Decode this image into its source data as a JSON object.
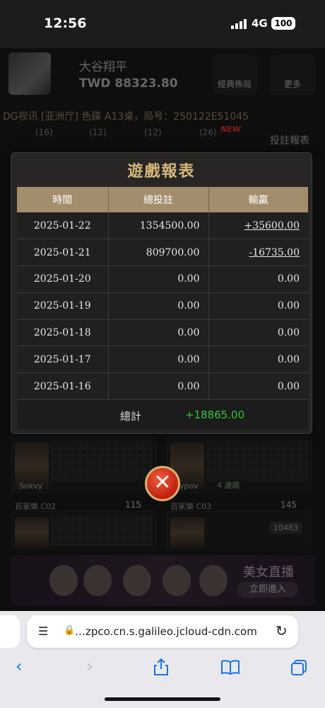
{
  "status_bar": {
    "time": "12:56",
    "network": "4G",
    "battery": "100"
  },
  "background": {
    "username": "大谷翔平",
    "balance": "TWD 88323.80",
    "buttons": [
      "經典佈局",
      "更多"
    ],
    "ticker": "DG视讯 [亚洲厅] 色碟 A13桌，局号：250122E51045",
    "report_label": "投註報表",
    "counts": [
      "(16)",
      "(12)",
      "(12)",
      "(26)"
    ],
    "new_badge": "NEW",
    "tiles": [
      {
        "dealer": "Sokvy"
      },
      {
        "dealer": "Sypov",
        "streak": "4 連跳"
      },
      {
        "name": "百家樂 C02",
        "bets": "115"
      },
      {
        "name": "百家樂 C03",
        "bets": "145",
        "amount": "10483"
      }
    ],
    "banner": {
      "title": "美女直播",
      "button": "立即進入"
    }
  },
  "modal": {
    "title": "遊戲報表",
    "columns": [
      "時間",
      "總投註",
      "輸贏"
    ],
    "rows": [
      {
        "date": "2025-01-22",
        "bet": "1354500.00",
        "win": "+35600.00",
        "type": "pos"
      },
      {
        "date": "2025-01-21",
        "bet": "809700.00",
        "win": "-16735.00",
        "type": "neg"
      },
      {
        "date": "2025-01-20",
        "bet": "0.00",
        "win": "0.00",
        "type": "zero"
      },
      {
        "date": "2025-01-19",
        "bet": "0.00",
        "win": "0.00",
        "type": "zero"
      },
      {
        "date": "2025-01-18",
        "bet": "0.00",
        "win": "0.00",
        "type": "zero"
      },
      {
        "date": "2025-01-17",
        "bet": "0.00",
        "win": "0.00",
        "type": "zero"
      },
      {
        "date": "2025-01-16",
        "bet": "0.00",
        "win": "0.00",
        "type": "zero"
      }
    ],
    "total_label": "總計",
    "total_value": "+18865.00",
    "close_icon": "close-icon"
  },
  "browser": {
    "url": "…zpco.cn.s.galileo.jcloud-cdn.com",
    "icons": [
      "tabs-overview-icon",
      "lock-icon",
      "reload-icon",
      "back-icon",
      "forward-icon",
      "share-icon",
      "bookmarks-icon",
      "tabs-icon"
    ]
  },
  "colors": {
    "positive": "#35c23a",
    "negative": "#e02a2a",
    "header_gold": "#a28d6c",
    "title_gold": "#d6b77a",
    "link_blue": "#1a73e8"
  }
}
